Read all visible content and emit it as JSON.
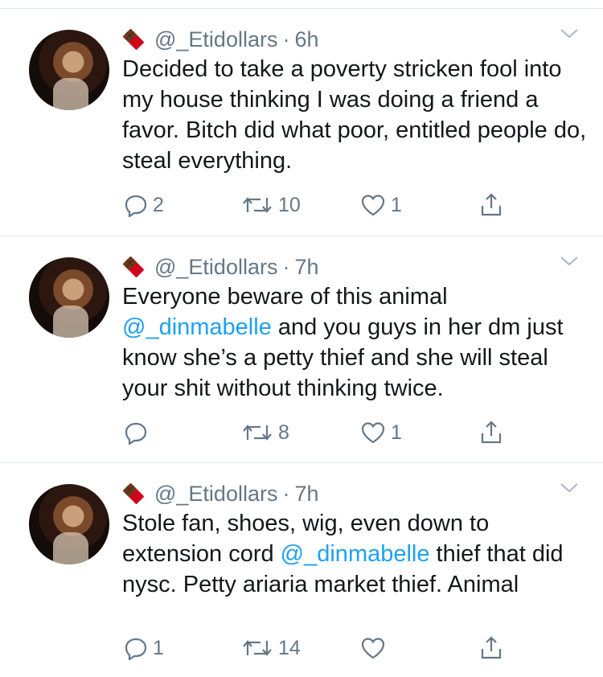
{
  "tweets": [
    {
      "handle": "@_Etidollars",
      "separator": "·",
      "time": "6h",
      "text_parts": [
        "Decided to take a poverty stricken fool into my house thinking I was doing a friend a favor. Bitch did what poor, entitled people do, steal everything."
      ],
      "replies": "2",
      "retweets": "10",
      "likes": "1"
    },
    {
      "handle": "@_Etidollars",
      "separator": "·",
      "time": "7h",
      "text_before": "Everyone beware of this animal",
      "mention": "@_dinmabelle",
      "text_after": " and you guys in her dm just know she’s a petty thief and she will steal your shit without thinking twice.",
      "replies": "",
      "retweets": "8",
      "likes": "1"
    },
    {
      "handle": "@_Etidollars",
      "separator": "·",
      "time": "7h",
      "text_before": "Stole fan, shoes, wig, even down to extension cord ",
      "mention": "@_dinmabelle",
      "text_after": " thief that did nysc. Petty ariaria market thief. Animal",
      "replies": "1",
      "retweets": "14",
      "likes": ""
    }
  ],
  "icons": {
    "badge": "chocolate-bar-icon",
    "menu": "chevron-down-icon",
    "reply": "reply-icon",
    "retweet": "retweet-icon",
    "like": "heart-icon",
    "share": "share-icon"
  },
  "colors": {
    "text": "#14171a",
    "secondary": "#657786",
    "mention": "#1da1f2",
    "divider": "#e1e8ed"
  }
}
